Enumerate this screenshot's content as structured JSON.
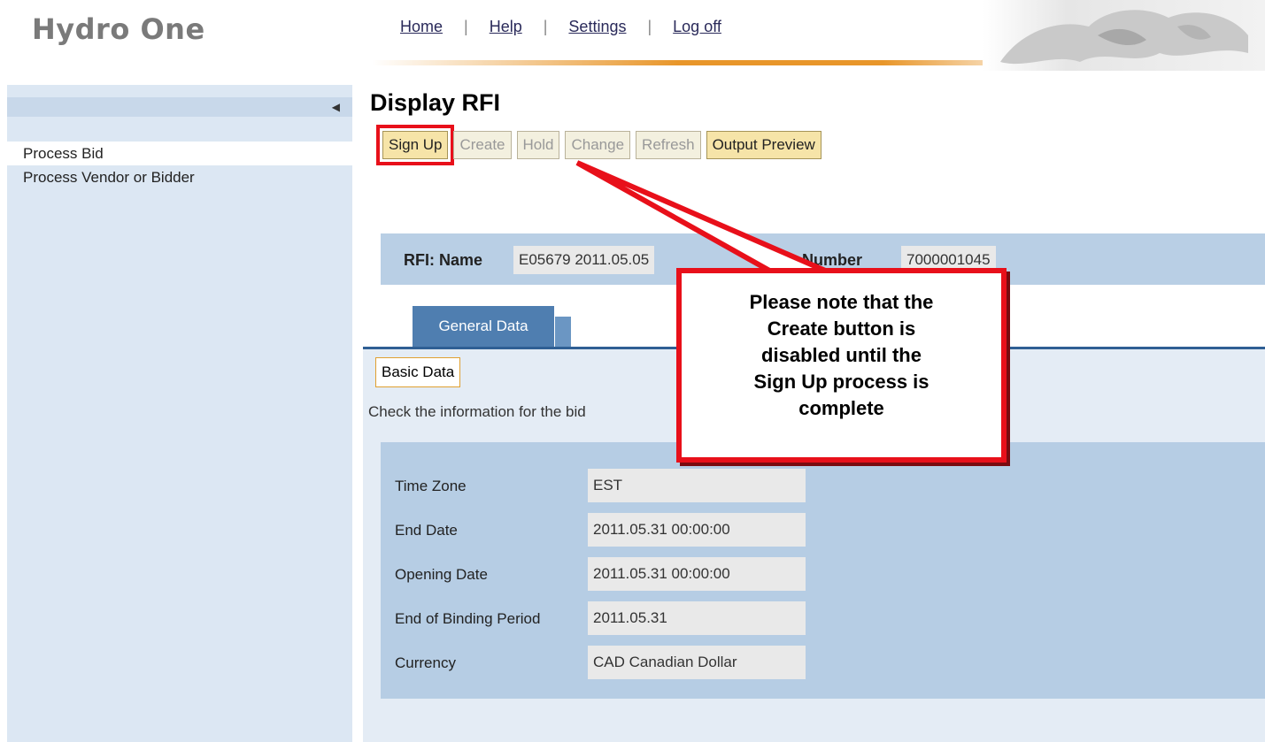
{
  "header": {
    "logo": "Hydro One",
    "nav": [
      {
        "label": "Home"
      },
      {
        "label": "Help"
      },
      {
        "label": "Settings"
      },
      {
        "label": "Log off"
      }
    ],
    "separator": "|"
  },
  "sidebar": {
    "items": [
      {
        "label": "Process Bid",
        "active": true
      },
      {
        "label": "Process Vendor or Bidder",
        "active": false
      }
    ]
  },
  "page": {
    "title": "Display RFI",
    "toolbar": [
      {
        "label": "Sign Up",
        "enabled": true
      },
      {
        "label": "Create",
        "enabled": false
      },
      {
        "label": "Hold",
        "enabled": false
      },
      {
        "label": "Change",
        "enabled": false
      },
      {
        "label": "Refresh",
        "enabled": false
      },
      {
        "label": "Output Preview",
        "enabled": true
      }
    ],
    "rfi": {
      "name_label": "RFI: Name",
      "name_value": "E05679 2011.05.05",
      "number_label": "Number",
      "number_value": "7000001045"
    },
    "tabs": [
      {
        "label": "General Data",
        "active": true
      }
    ],
    "subtab": "Basic Data",
    "check_text": "Check the information for the bid",
    "fields": [
      {
        "label": "Time Zone",
        "value": "EST"
      },
      {
        "label": "End Date",
        "value": "2011.05.31   00:00:00"
      },
      {
        "label": "Opening Date",
        "value": "2011.05.31 00:00:00"
      },
      {
        "label": "End of Binding Period",
        "value": "2011.05.31"
      },
      {
        "label": "Currency",
        "value": "CAD  Canadian Dollar"
      }
    ]
  },
  "callout": {
    "lines": [
      "Please note that the",
      "Create button is",
      "disabled until the",
      "Sign Up process is",
      "complete"
    ]
  },
  "colors": {
    "highlight": "#e8101a",
    "sidebar": "#dce7f3",
    "panel": "#b6cde4",
    "tab": "#4f7eb0"
  }
}
